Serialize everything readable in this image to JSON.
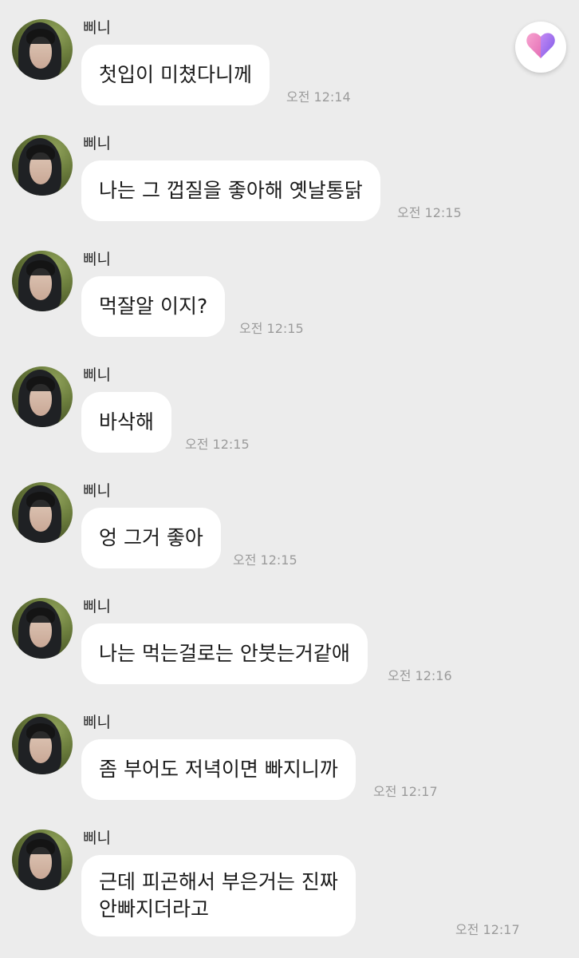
{
  "messages": [
    {
      "sender": "삐니",
      "text": "첫입이 미쳤다니께",
      "time": "오전 12:14"
    },
    {
      "sender": "삐니",
      "text": "나는 그 껍질을 좋아해 옛날통닭",
      "time": "오전 12:15"
    },
    {
      "sender": "삐니",
      "text": "먹잘알 이지?",
      "time": "오전 12:15"
    },
    {
      "sender": "삐니",
      "text": "바삭해",
      "time": "오전 12:15"
    },
    {
      "sender": "삐니",
      "text": "엉 그거 좋아",
      "time": "오전 12:15"
    },
    {
      "sender": "삐니",
      "text": "나는 먹는걸로는 안붓는거같애",
      "time": "오전 12:16"
    },
    {
      "sender": "삐니",
      "text": "좀 부어도 저녁이면 빠지니까",
      "time": "오전 12:17"
    },
    {
      "sender": "삐니",
      "text": "근데 피곤해서 부은거는 진짜\n안빠지더라고",
      "time": "오전 12:17"
    }
  ],
  "heart_button": {
    "icon": "heart-icon",
    "colors": [
      "#f28bc6",
      "#9b6cf0"
    ]
  }
}
